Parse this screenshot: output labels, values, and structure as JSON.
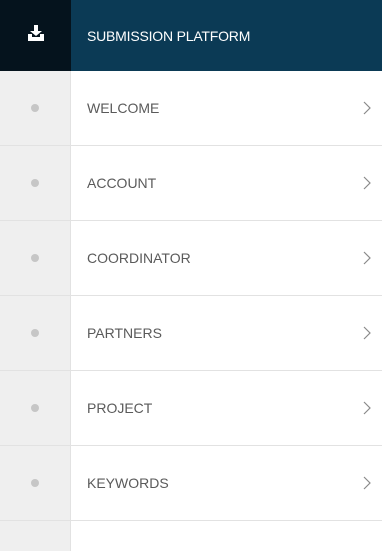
{
  "header": {
    "icon": "download-icon",
    "title": "SUBMISSION PLATFORM"
  },
  "menu": {
    "items": [
      {
        "label": "WELCOME",
        "status_icon": "status-dot",
        "arrow_icon": "chevron-right-icon"
      },
      {
        "label": "ACCOUNT",
        "status_icon": "status-dot",
        "arrow_icon": "chevron-right-icon"
      },
      {
        "label": "COORDINATOR",
        "status_icon": "status-dot",
        "arrow_icon": "chevron-right-icon"
      },
      {
        "label": "PARTNERS",
        "status_icon": "status-dot",
        "arrow_icon": "chevron-right-icon"
      },
      {
        "label": "PROJECT",
        "status_icon": "status-dot",
        "arrow_icon": "chevron-right-icon"
      },
      {
        "label": "KEYWORDS",
        "status_icon": "status-dot",
        "arrow_icon": "chevron-right-icon"
      }
    ]
  },
  "colors": {
    "header_icon_bg": "#05131d",
    "header_title_bg": "#0b3a55",
    "status_column_bg": "#efefef",
    "status_dot": "#c6c6c6",
    "label_text": "#5a5a5a"
  }
}
